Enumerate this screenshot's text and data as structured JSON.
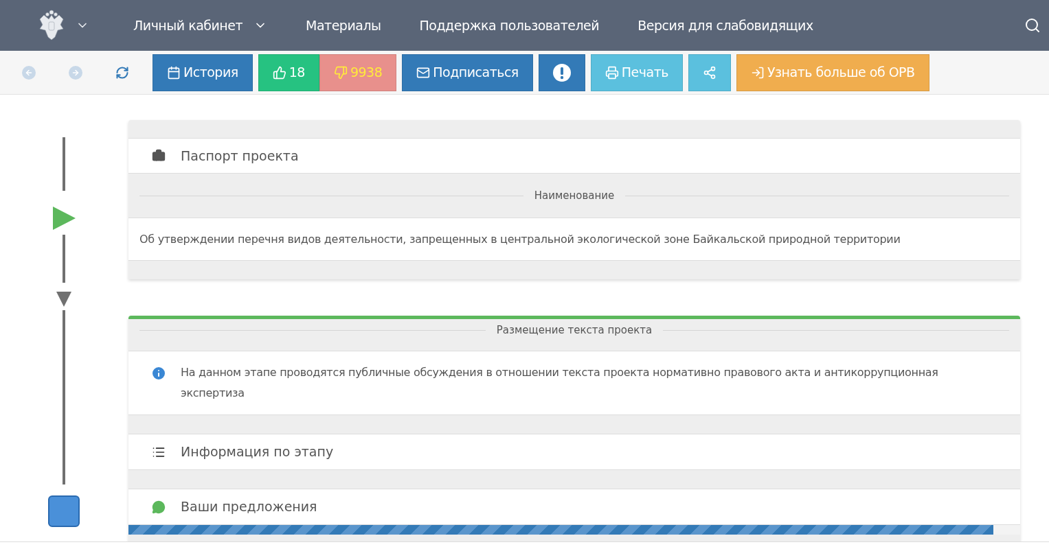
{
  "nav": {
    "items": [
      {
        "label": "Личный кабинет",
        "dropdown": true
      },
      {
        "label": "Материалы",
        "dropdown": false
      },
      {
        "label": "Поддержка пользователей",
        "dropdown": false
      },
      {
        "label": "Версия для слабовидящих",
        "dropdown": false
      }
    ]
  },
  "toolbar": {
    "nav_buttons": [
      {
        "kind": "back",
        "disabled": true
      },
      {
        "kind": "forward",
        "disabled": true
      },
      {
        "kind": "refresh",
        "disabled": false
      }
    ],
    "buttons": [
      {
        "kind": "history",
        "label": "История"
      },
      {
        "kind": "like",
        "label": "18"
      },
      {
        "kind": "dislike",
        "label": "9938"
      },
      {
        "kind": "subscribe",
        "label": "Подписаться"
      },
      {
        "kind": "alert"
      },
      {
        "kind": "print",
        "label": "Печать"
      },
      {
        "kind": "share"
      },
      {
        "kind": "learn",
        "label": "Узнать больше об ОРВ"
      }
    ]
  },
  "passport": {
    "title": "Паспорт проекта",
    "section_label": "Наименование",
    "name": "Об утверждении перечня видов деятельности, запрещенных в центральной экологической зоне Байкальской природной территории"
  },
  "stage": {
    "title": "Размещение текста проекта",
    "notice": "На данном этапе проводятся публичные обсуждения в отношении текста проекта нормативно правового акта и антикоррупционная экспертиза",
    "rows": [
      {
        "kind": "info",
        "label": "Информация по этапу"
      },
      {
        "kind": "proposals",
        "label": "Ваши предложения"
      }
    ],
    "progress": {
      "level": 0.97
    }
  }
}
